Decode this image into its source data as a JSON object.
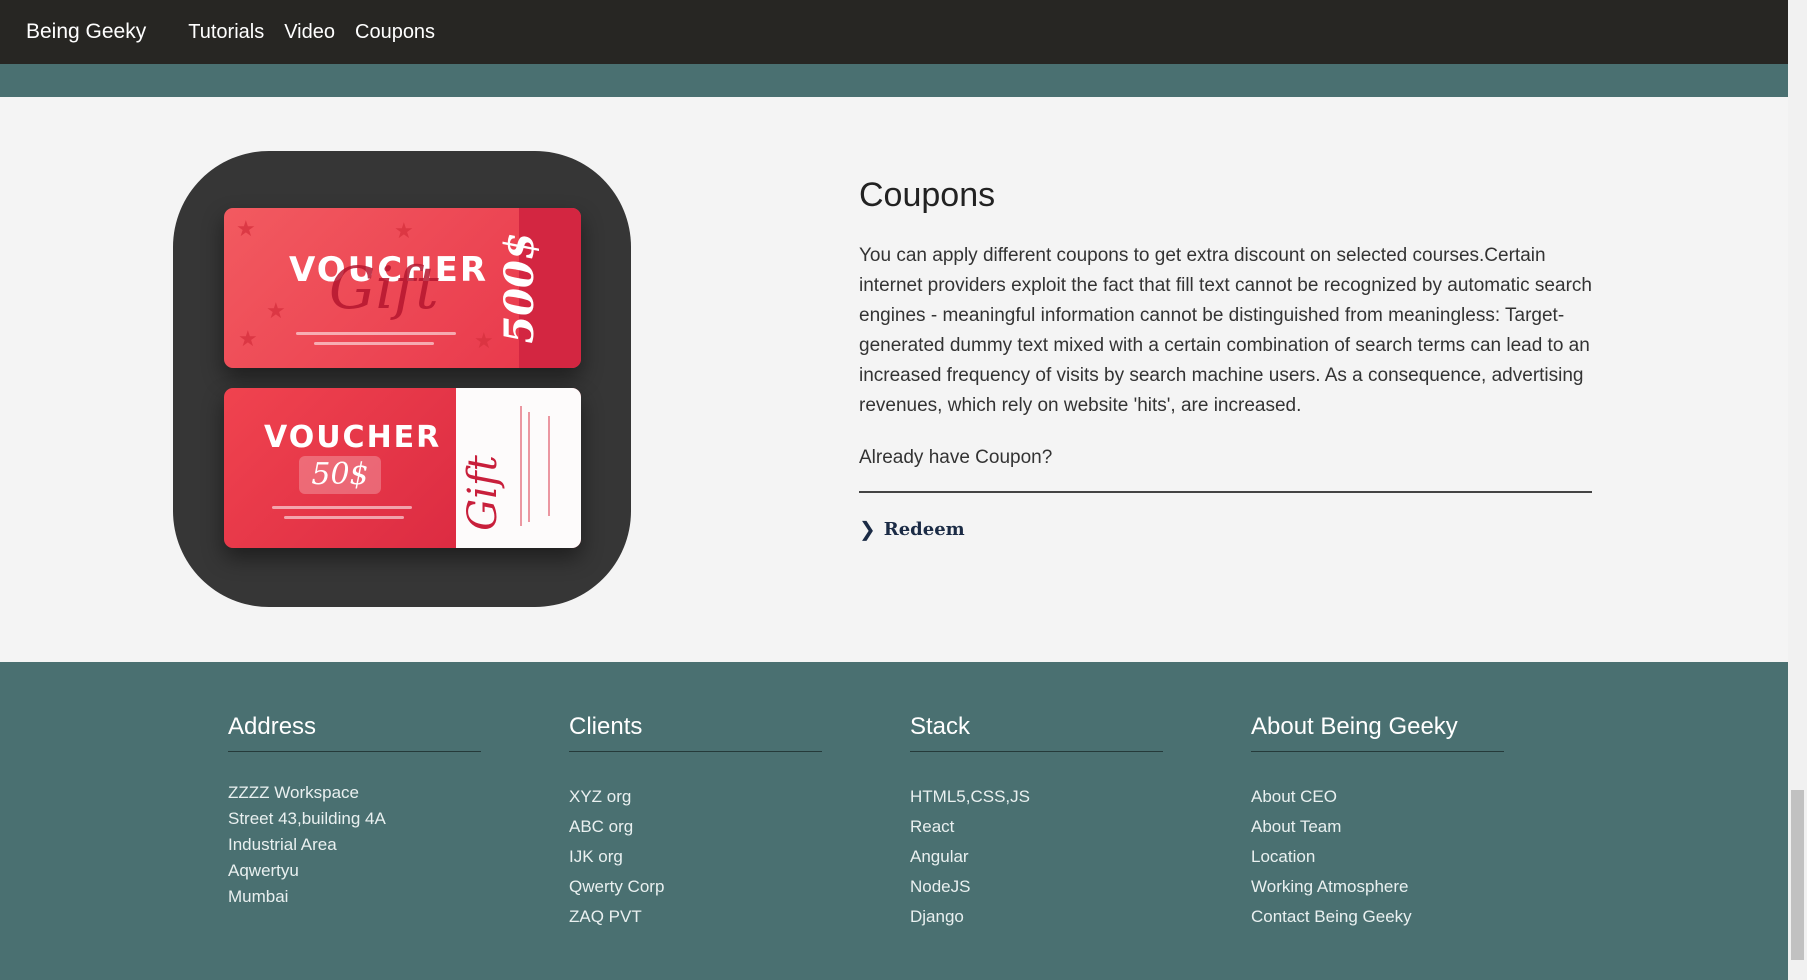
{
  "navbar": {
    "brand": "Being Geeky",
    "links": [
      "Tutorials",
      "Video",
      "Coupons"
    ]
  },
  "hero_image": {
    "voucher_top": {
      "title": "VOUCHER",
      "script": "Gift",
      "amount": "500$"
    },
    "voucher_bottom": {
      "title": "VOUCHER",
      "amount": "50$",
      "script": "Gift"
    }
  },
  "coupons": {
    "title": "Coupons",
    "body": "You can apply different coupons to get extra discount on selected courses.Certain internet providers exploit the fact that fill text cannot be recognized by automatic search engines - meaningful information cannot be distinguished from meaningless: Target-generated dummy text mixed with a certain combination of search terms can lead to an increased frequency of visits by search machine users. As a consequence, advertising revenues, which rely on website 'hits', are increased.",
    "question": "Already have Coupon?",
    "redeem_label": "Redeem"
  },
  "footer": {
    "address": {
      "title": "Address",
      "lines": [
        "ZZZZ Workspace",
        "Street 43,building 4A",
        "Industrial Area",
        "Aqwertyu",
        "Mumbai"
      ]
    },
    "clients": {
      "title": "Clients",
      "items": [
        "XYZ org",
        "ABC org",
        "IJK org",
        "Qwerty Corp",
        "ZAQ PVT"
      ]
    },
    "stack": {
      "title": "Stack",
      "items": [
        "HTML5,CSS,JS",
        "React",
        "Angular",
        "NodeJS",
        "Django"
      ]
    },
    "about": {
      "title": "About Being Geeky",
      "items": [
        "About CEO",
        "About Team",
        "Location",
        "Working Atmosphere",
        "Contact Being Geeky"
      ]
    }
  },
  "colors": {
    "navbar": "#272623",
    "teal": "#4a7071",
    "background": "#f4f4f4",
    "voucher_red": "#e8364a"
  }
}
